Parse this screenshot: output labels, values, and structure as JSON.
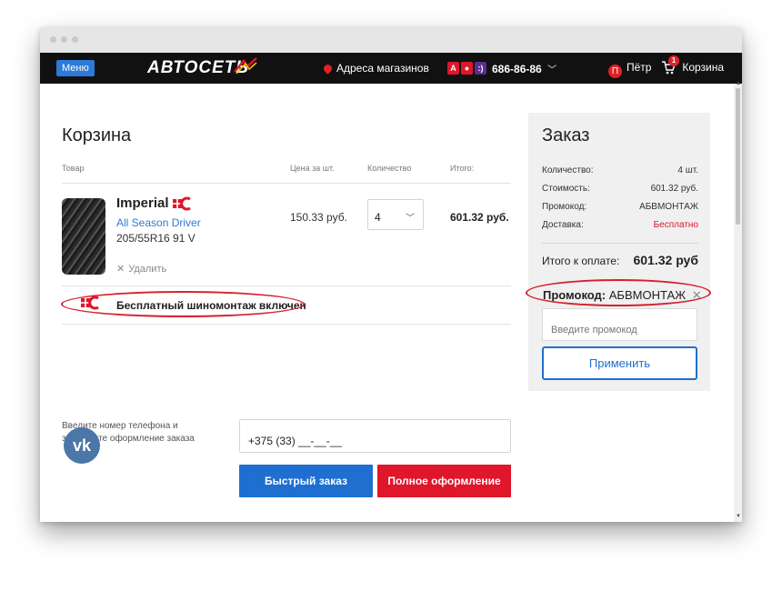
{
  "nav": {
    "menu_label": "Меню",
    "logo_text": "АВТОСЕТЬ",
    "stores_label": "Адреса магазинов",
    "phone_label": "686-86-86",
    "user_name": "Пётр",
    "user_initial": "П",
    "cart_label": "Корзина",
    "cart_count": "1",
    "badges": [
      "A",
      "●",
      ":)"
    ]
  },
  "cart": {
    "title": "Корзина",
    "headers": {
      "product": "Товар",
      "price": "Цена за шт.",
      "quantity": "Количество",
      "total": "Итого:"
    },
    "item": {
      "brand": "Imperial",
      "model": "All Season Driver",
      "size": "205/55R16 91 V",
      "remove_label": "Удалить",
      "price": "150.33 руб.",
      "quantity": "4",
      "total": "601.32 руб."
    },
    "service_label": "Бесплатный шиномонтаж включен"
  },
  "checkout": {
    "phone_prompt_line1": "Введите номер телефона и",
    "phone_prompt_line2": "завершите оформление заказа",
    "phone_value": "+375 (33) __-__-__",
    "fast_order_label": "Быстрый заказ",
    "full_order_label": "Полное оформление"
  },
  "order": {
    "title": "Заказ",
    "rows": [
      {
        "label": "Количество:",
        "value": "4 шт."
      },
      {
        "label": "Стоимость:",
        "value": "601.32 руб."
      },
      {
        "label": "Промокод:",
        "value": "АБВМОНТАЖ"
      },
      {
        "label": "Доставка:",
        "value": "Бесплатно"
      }
    ],
    "to_pay_label": "Итого к оплате:",
    "to_pay_value": "601.32 руб",
    "promo_label": "Промокод:",
    "promo_value": "АБВМОНТАЖ",
    "promo_placeholder": "Введите промокод",
    "apply_label": "Применить"
  },
  "colors": {
    "brand_red": "#e0162b",
    "brand_blue": "#1f6fd1",
    "nav_bg": "#111111",
    "highlight_ellipse": "#d3232f"
  }
}
